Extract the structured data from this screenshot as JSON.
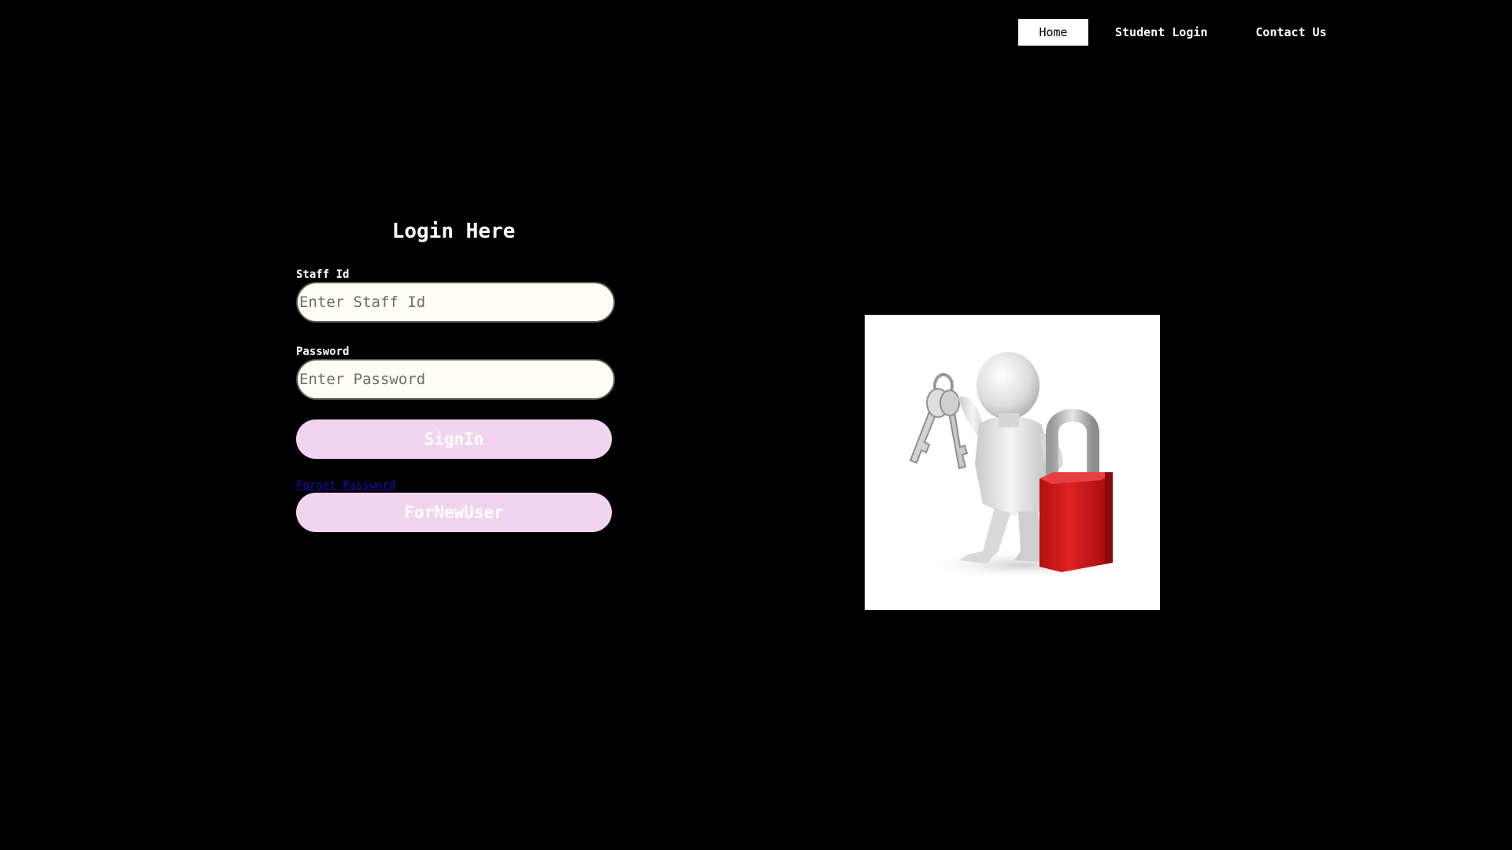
{
  "nav": {
    "items": [
      {
        "label": "Home",
        "active": true
      },
      {
        "label": "Student Login",
        "active": false
      },
      {
        "label": "Contact Us",
        "active": false
      }
    ]
  },
  "login": {
    "title": "Login Here",
    "staff_label": "Staff Id",
    "staff_placeholder": "Enter Staff Id",
    "staff_value": "",
    "password_label": "Password",
    "password_placeholder": "Enter Password",
    "password_value": "",
    "signin_label": "SignIn",
    "forget_label": "Forget Password",
    "newuser_label": "ForNewUser"
  },
  "illustration": {
    "icon": "person-with-keys-and-padlock-icon"
  },
  "colors": {
    "background": "#000000",
    "input_bg": "#fefef2",
    "button_bg": "#f2d4f0",
    "link": "#1a0dab",
    "padlock": "#d91c1c"
  }
}
